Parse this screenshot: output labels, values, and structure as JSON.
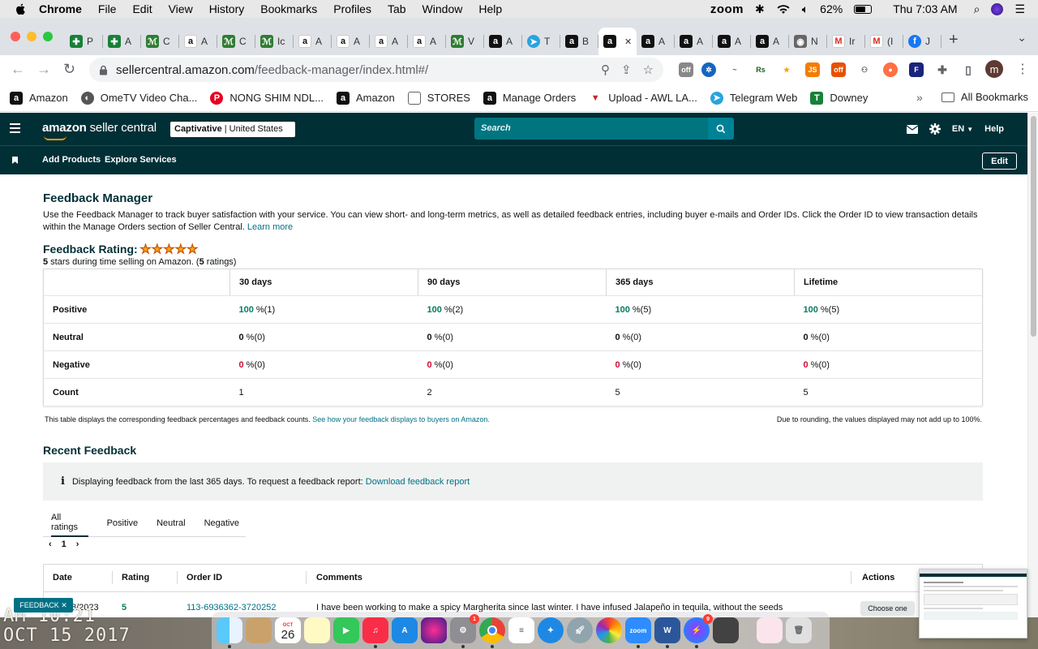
{
  "menubar": {
    "app": "Chrome",
    "items": [
      "File",
      "Edit",
      "View",
      "History",
      "Bookmarks",
      "Profiles",
      "Tab",
      "Window",
      "Help"
    ],
    "zoom": "zoom",
    "battery": "62%",
    "clock": "Thu 7:03 AM"
  },
  "tabs": [
    {
      "icon": "google-sheets-icon",
      "label": "P",
      "color": "#188038"
    },
    {
      "icon": "google-sheets-icon",
      "label": "A",
      "color": "#188038"
    },
    {
      "icon": "ups-icon",
      "label": "C",
      "color": "#2e7d32"
    },
    {
      "icon": "amazon-icon",
      "label": "A",
      "color": "#fff"
    },
    {
      "icon": "ups-icon",
      "label": "C",
      "color": "#2e7d32"
    },
    {
      "icon": "ups-icon",
      "label": "Ic",
      "color": "#2e7d32"
    },
    {
      "icon": "amazon-icon",
      "label": "A",
      "color": "#fff"
    },
    {
      "icon": "amazon-icon",
      "label": "A",
      "color": "#fff"
    },
    {
      "icon": "amazon-icon",
      "label": "A",
      "color": "#fff"
    },
    {
      "icon": "amazon-icon",
      "label": "A",
      "color": "#fff"
    },
    {
      "icon": "ups-icon",
      "label": "V",
      "color": "#2e7d32"
    },
    {
      "icon": "amazon-dark-icon",
      "label": "A",
      "color": "#111"
    },
    {
      "icon": "telegram-icon",
      "label": "T",
      "color": "#2aa3df"
    },
    {
      "icon": "amazon-dark-icon",
      "label": "B",
      "color": "#111"
    },
    {
      "icon": "amazon-dark-icon",
      "label": "",
      "color": "#111",
      "active": true
    },
    {
      "icon": "amazon-dark-icon",
      "label": "A",
      "color": "#111"
    },
    {
      "icon": "amazon-dark-icon",
      "label": "A",
      "color": "#111"
    },
    {
      "icon": "amazon-dark-icon",
      "label": "A",
      "color": "#111"
    },
    {
      "icon": "amazon-dark-icon",
      "label": "A",
      "color": "#111"
    },
    {
      "icon": "chrome-icon",
      "label": "N",
      "color": "#666"
    },
    {
      "icon": "gmail-icon",
      "label": "Ir",
      "color": "#fff"
    },
    {
      "icon": "gmail-icon",
      "label": "(I",
      "color": "#fff"
    },
    {
      "icon": "facebook-icon",
      "label": "J",
      "color": "#1877f2"
    }
  ],
  "address": {
    "host": "sellercentral.amazon.com",
    "path": "/feedback-manager/index.html#/"
  },
  "bookmarks": [
    {
      "icon": "amazon-icon",
      "label": "Amazon"
    },
    {
      "icon": "ometv-icon",
      "label": "OmeTV Video Cha..."
    },
    {
      "icon": "pinterest-icon",
      "label": "NONG SHIM NDL..."
    },
    {
      "icon": "amazon-icon",
      "label": "Amazon"
    },
    {
      "icon": "folder-icon",
      "label": "STORES"
    },
    {
      "icon": "amazon-icon",
      "label": "Manage Orders"
    },
    {
      "icon": "upload-icon",
      "label": "Upload - AWL LA..."
    },
    {
      "icon": "telegram-icon",
      "label": "Telegram Web"
    },
    {
      "icon": "sheets-icon",
      "label": "Downey"
    }
  ],
  "bookmarks_all": "All Bookmarks",
  "sc": {
    "logo_bold": "amazon",
    "logo_rest": " seller central",
    "account_name": "Captivative",
    "account_region": " | United States",
    "search_placeholder": "Search",
    "lang": "EN",
    "help": "Help",
    "subnav": [
      "Add Products",
      "Explore Services"
    ],
    "edit": "Edit"
  },
  "page": {
    "title": "Feedback Manager",
    "description": "Use the Feedback Manager to track buyer satisfaction with your service. You can view short- and long-term metrics, as well as detailed feedback entries, including buyer e-mails and Order IDs. Click the Order ID to view transaction details within the Manage Orders section of Seller Central.",
    "learn_more": "Learn more",
    "rating_label": "Feedback Rating:",
    "stars": 5,
    "rating_sub_bold": "5",
    "rating_sub_mid": " stars during time selling on Amazon. (",
    "rating_count": "5",
    "rating_sub_end": " ratings)"
  },
  "feedback_table": {
    "columns": [
      "30 days",
      "90 days",
      "365 days",
      "Lifetime"
    ],
    "rows": [
      {
        "label": "Positive",
        "cells": [
          {
            "pct": "100",
            "rest": " %(1)"
          },
          {
            "pct": "100",
            "rest": " %(2)"
          },
          {
            "pct": "100",
            "rest": " %(5)"
          },
          {
            "pct": "100",
            "rest": " %(5)"
          }
        ]
      },
      {
        "label": "Neutral",
        "cells": [
          {
            "pct": "0",
            "rest": " %(0)"
          },
          {
            "pct": "0",
            "rest": " %(0)"
          },
          {
            "pct": "0",
            "rest": " %(0)"
          },
          {
            "pct": "0",
            "rest": " %(0)"
          }
        ]
      },
      {
        "label": "Negative",
        "cells": [
          {
            "pct": "0",
            "rest": " %(0)"
          },
          {
            "pct": "0",
            "rest": " %(0)"
          },
          {
            "pct": "0",
            "rest": " %(0)"
          },
          {
            "pct": "0",
            "rest": " %(0)"
          }
        ]
      },
      {
        "label": "Count",
        "cells": [
          {
            "pct": "",
            "rest": "1"
          },
          {
            "pct": "",
            "rest": "2"
          },
          {
            "pct": "",
            "rest": "5"
          },
          {
            "pct": "",
            "rest": "5"
          }
        ]
      }
    ],
    "note_left": "This table displays the corresponding feedback percentages and feedback counts.",
    "note_link": "See how your feedback displays to buyers on Amazon.",
    "note_right": "Due to rounding, the values displayed may not add up to 100%."
  },
  "recent": {
    "title": "Recent Feedback",
    "info": "Displaying feedback from the last 365 days. To request a feedback report:",
    "info_link": "Download feedback report",
    "tabs": [
      "All ratings",
      "Positive",
      "Neutral",
      "Negative"
    ],
    "page": "1",
    "headers": [
      "Date",
      "Rating",
      "Order ID",
      "Comments",
      "Actions"
    ],
    "row": {
      "date": "8/2023",
      "rating": "5",
      "order_id": "113-6936362-3720252",
      "comment": "I have been working to make a spicy Margherita since last winter. I have infused Jalapeño in tequila, without the seeds",
      "action": "Choose one"
    }
  },
  "feedback_tab": "FEEDBACK ✕",
  "desktop_stamp": [
    "AM 10:21",
    "OCT 15 2017"
  ],
  "dock_badges": {
    "calendar_day": "26",
    "calendar_month": "OCT",
    "mail_badge": "1",
    "messenger_badge": "9"
  }
}
